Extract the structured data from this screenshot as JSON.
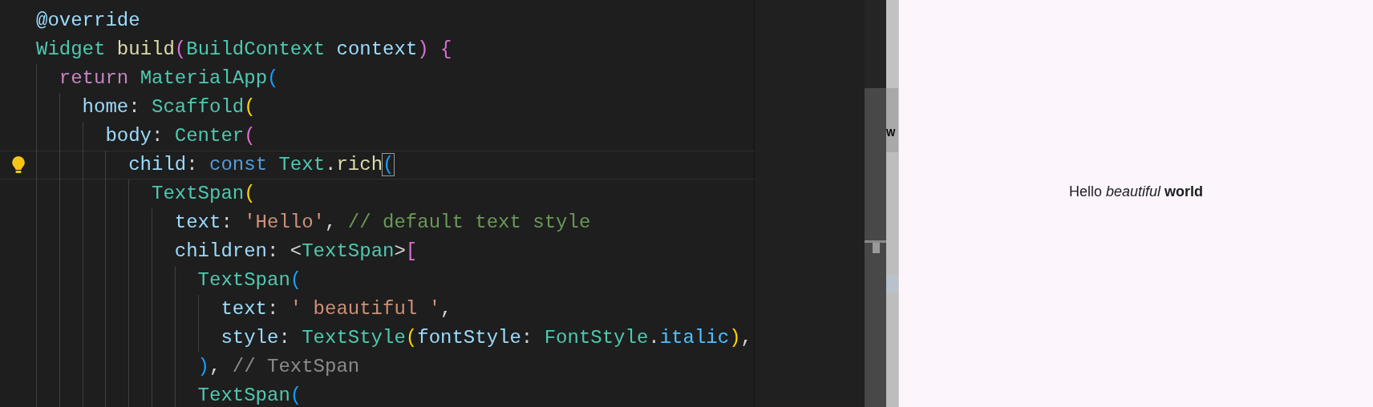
{
  "editor": {
    "lines": [
      {
        "tokens": [
          {
            "text": "@override",
            "kind": "variable"
          }
        ]
      },
      {
        "tokens": [
          {
            "text": "Widget ",
            "kind": "type"
          },
          {
            "text": "build",
            "kind": "function"
          },
          {
            "text": "(",
            "kind": "bracket2"
          },
          {
            "text": "BuildContext ",
            "kind": "type"
          },
          {
            "text": "context",
            "kind": "variable"
          },
          {
            "text": ") {",
            "kind": "bracket2"
          }
        ],
        "children": [
          {
            "tokens": [
              {
                "text": "return ",
                "kind": "control"
              },
              {
                "text": "MaterialApp",
                "kind": "type"
              },
              {
                "text": "(",
                "kind": "bracket3"
              }
            ],
            "children": [
              {
                "tokens": [
                  {
                    "text": "home",
                    "kind": "variable"
                  },
                  {
                    "text": ": ",
                    "kind": "plain"
                  },
                  {
                    "text": "Scaffold",
                    "kind": "type"
                  },
                  {
                    "text": "(",
                    "kind": "bracket1"
                  }
                ],
                "children": [
                  {
                    "tokens": [
                      {
                        "text": "body",
                        "kind": "variable"
                      },
                      {
                        "text": ": ",
                        "kind": "plain"
                      },
                      {
                        "text": "Center",
                        "kind": "type"
                      },
                      {
                        "text": "(",
                        "kind": "bracket2"
                      }
                    ],
                    "children": [
                      {
                        "current": true,
                        "lightbulb": true,
                        "tokens": [
                          {
                            "text": "child",
                            "kind": "variable"
                          },
                          {
                            "text": ": ",
                            "kind": "plain"
                          },
                          {
                            "text": "const ",
                            "kind": "keyword"
                          },
                          {
                            "text": "Text",
                            "kind": "type"
                          },
                          {
                            "text": ".",
                            "kind": "plain"
                          },
                          {
                            "text": "rich",
                            "kind": "function"
                          },
                          {
                            "text": "(",
                            "kind": "bracket3",
                            "cursor": true
                          }
                        ],
                        "children": [
                          {
                            "tokens": [
                              {
                                "text": "TextSpan",
                                "kind": "type"
                              },
                              {
                                "text": "(",
                                "kind": "bracket1"
                              }
                            ],
                            "children": [
                              {
                                "tokens": [
                                  {
                                    "text": "text",
                                    "kind": "variable"
                                  },
                                  {
                                    "text": ": ",
                                    "kind": "plain"
                                  },
                                  {
                                    "text": "'Hello'",
                                    "kind": "string"
                                  },
                                  {
                                    "text": ", ",
                                    "kind": "plain"
                                  },
                                  {
                                    "text": "// default text style",
                                    "kind": "comment"
                                  }
                                ]
                              },
                              {
                                "tokens": [
                                  {
                                    "text": "children",
                                    "kind": "variable"
                                  },
                                  {
                                    "text": ": <",
                                    "kind": "plain"
                                  },
                                  {
                                    "text": "TextSpan",
                                    "kind": "type"
                                  },
                                  {
                                    "text": ">",
                                    "kind": "plain"
                                  },
                                  {
                                    "text": "[",
                                    "kind": "bracket2"
                                  }
                                ],
                                "children": [
                                  {
                                    "tokens": [
                                      {
                                        "text": "TextSpan",
                                        "kind": "type"
                                      },
                                      {
                                        "text": "(",
                                        "kind": "bracket3"
                                      }
                                    ],
                                    "children": [
                                      {
                                        "tokens": [
                                          {
                                            "text": "text",
                                            "kind": "variable"
                                          },
                                          {
                                            "text": ": ",
                                            "kind": "plain"
                                          },
                                          {
                                            "text": "' beautiful '",
                                            "kind": "string"
                                          },
                                          {
                                            "text": ",",
                                            "kind": "plain"
                                          }
                                        ]
                                      },
                                      {
                                        "tokens": [
                                          {
                                            "text": "style",
                                            "kind": "variable"
                                          },
                                          {
                                            "text": ": ",
                                            "kind": "plain"
                                          },
                                          {
                                            "text": "TextStyle",
                                            "kind": "type"
                                          },
                                          {
                                            "text": "(",
                                            "kind": "bracket1"
                                          },
                                          {
                                            "text": "fontStyle",
                                            "kind": "variable"
                                          },
                                          {
                                            "text": ": ",
                                            "kind": "plain"
                                          },
                                          {
                                            "text": "FontStyle",
                                            "kind": "type"
                                          },
                                          {
                                            "text": ".",
                                            "kind": "plain"
                                          },
                                          {
                                            "text": "italic",
                                            "kind": "enum"
                                          },
                                          {
                                            "text": ")",
                                            "kind": "bracket1"
                                          },
                                          {
                                            "text": ",",
                                            "kind": "plain"
                                          }
                                        ]
                                      }
                                    ]
                                  },
                                  {
                                    "tokens": [
                                      {
                                        "text": ")",
                                        "kind": "bracket3"
                                      },
                                      {
                                        "text": ", ",
                                        "kind": "plain"
                                      },
                                      {
                                        "text": "// TextSpan",
                                        "kind": "label"
                                      }
                                    ]
                                  },
                                  {
                                    "tokens": [
                                      {
                                        "text": "TextSpan",
                                        "kind": "type"
                                      },
                                      {
                                        "text": "(",
                                        "kind": "bracket3"
                                      }
                                    ]
                                  }
                                ]
                              }
                            ]
                          }
                        ]
                      }
                    ]
                  }
                ]
              }
            ]
          }
        ]
      }
    ]
  },
  "side_strip": {
    "text": "W"
  },
  "preview": {
    "text": "Hello *beautiful* **world**"
  }
}
